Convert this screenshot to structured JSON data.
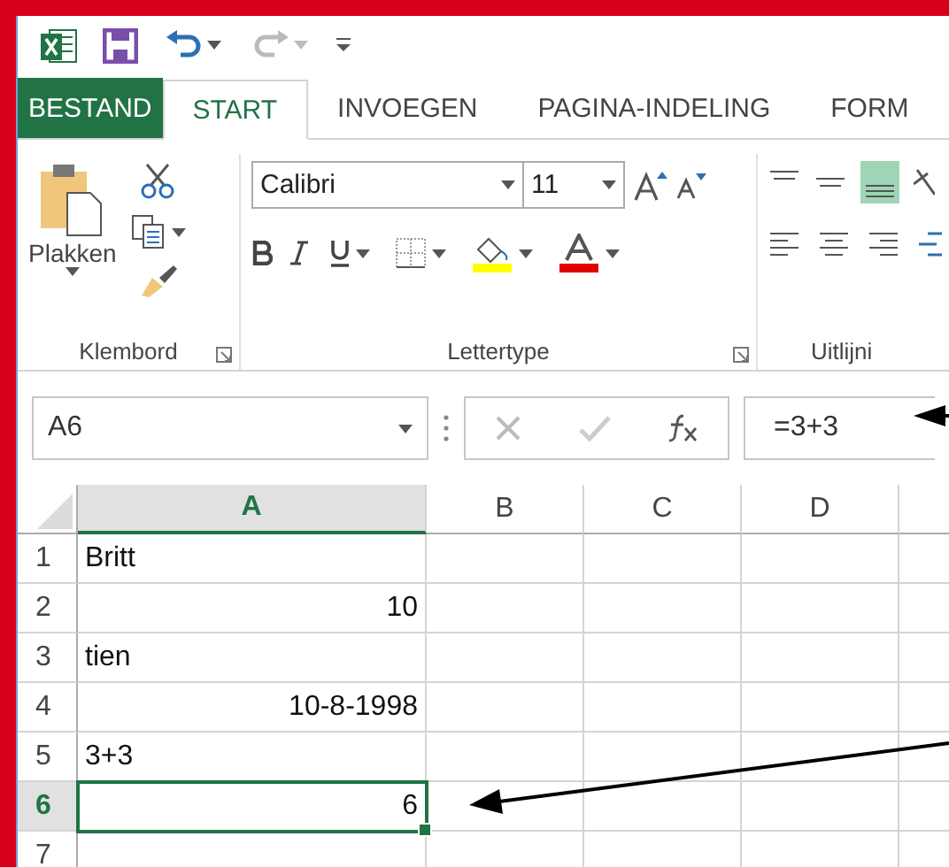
{
  "tabs": [
    {
      "label": "BESTAND",
      "kind": "file",
      "selected": false
    },
    {
      "label": "START",
      "kind": "tab",
      "selected": true
    },
    {
      "label": "INVOEGEN",
      "kind": "tab",
      "selected": false
    },
    {
      "label": "PAGINA-INDELING",
      "kind": "tab",
      "selected": false
    },
    {
      "label": "FORM",
      "kind": "tab",
      "selected": false
    }
  ],
  "ribbon": {
    "clipboard": {
      "paste_label": "Plakken",
      "group_label": "Klembord"
    },
    "font": {
      "font_name": "Calibri",
      "font_size": "11",
      "group_label": "Lettertype"
    },
    "alignment": {
      "group_label": "Uitlijni"
    }
  },
  "formula_bar": {
    "name_box": "A6",
    "formula": "=3+3"
  },
  "columns": [
    {
      "label": "A",
      "selected": true
    },
    {
      "label": "B",
      "selected": false
    },
    {
      "label": "C",
      "selected": false
    },
    {
      "label": "D",
      "selected": false
    }
  ],
  "rows": [
    {
      "number": "1",
      "selected": false,
      "cells": [
        {
          "text": "Britt",
          "right_aligned": false,
          "selected": false
        }
      ]
    },
    {
      "number": "2",
      "selected": false,
      "cells": [
        {
          "text": "10",
          "right_aligned": true,
          "selected": false
        }
      ]
    },
    {
      "number": "3",
      "selected": false,
      "cells": [
        {
          "text": "tien",
          "right_aligned": false,
          "selected": false
        }
      ]
    },
    {
      "number": "4",
      "selected": false,
      "cells": [
        {
          "text": "10-8-1998",
          "right_aligned": true,
          "selected": false
        }
      ]
    },
    {
      "number": "5",
      "selected": false,
      "cells": [
        {
          "text": "3+3",
          "right_aligned": false,
          "selected": false
        }
      ]
    },
    {
      "number": "6",
      "selected": true,
      "cells": [
        {
          "text": "6",
          "right_aligned": true,
          "selected": true
        }
      ]
    },
    {
      "number": "7",
      "selected": false,
      "cells": []
    }
  ]
}
